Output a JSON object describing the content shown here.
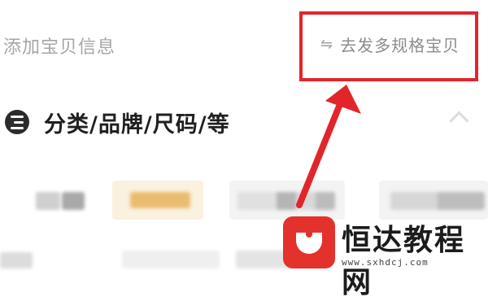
{
  "header": {
    "title": "添加宝贝信息",
    "multi_spec_label": "去发多规格宝贝",
    "multi_spec_icon": "swap-arrows-icon"
  },
  "section": {
    "title": "分类/品牌/尺码/等",
    "icon": "list-lines-icon",
    "collapse_icon": "chevron-up-icon"
  },
  "annotation": {
    "highlight_color": "#e2252b",
    "arrow_color": "#e2252b"
  },
  "watermark": {
    "brand": "恒达教程网",
    "url": "www.sxhdcj.com",
    "logo_color": "#e3322b"
  }
}
